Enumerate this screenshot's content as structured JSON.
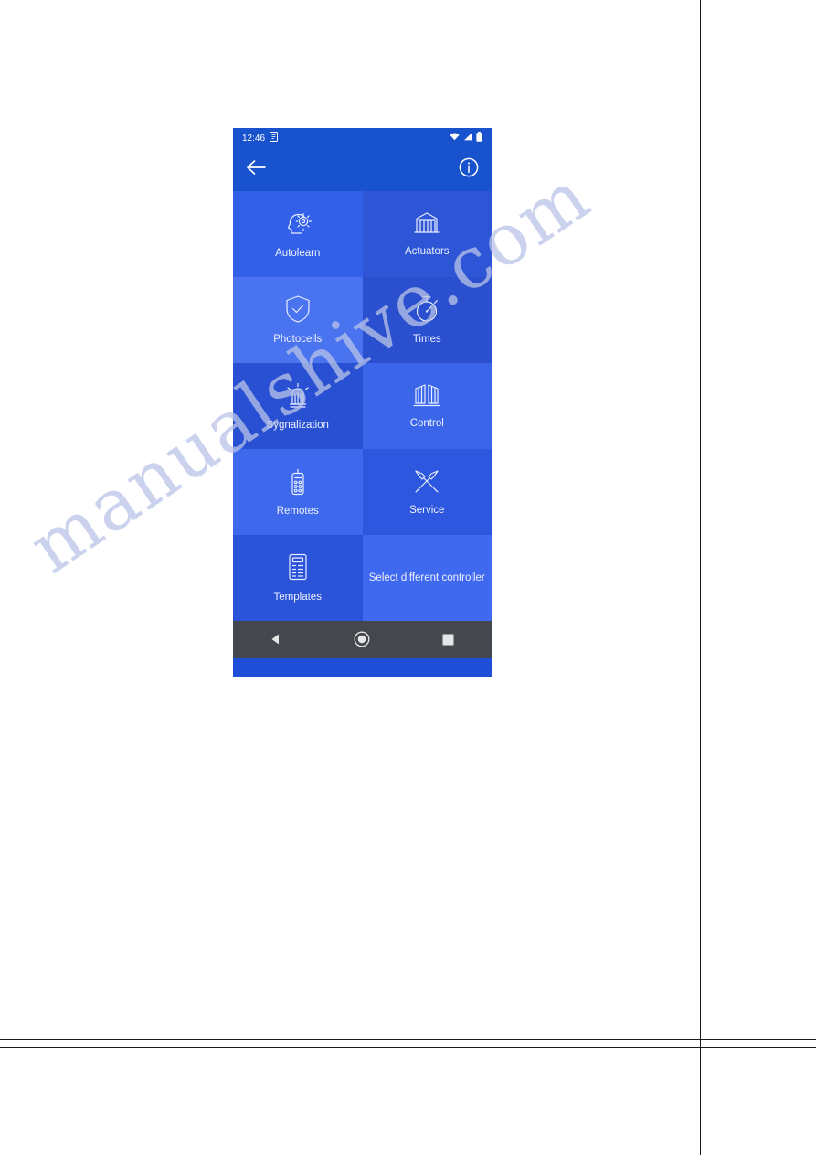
{
  "page": {
    "watermark_text": "manualshive.com"
  },
  "phone": {
    "status_bar": {
      "time": "12:46",
      "icons": [
        "screenshot-icon",
        "wifi-icon",
        "signal-icon",
        "battery-icon"
      ]
    },
    "app_bar": {
      "back_icon": "back-arrow-icon",
      "info_icon": "info-icon"
    },
    "tiles": [
      {
        "label": "Autolearn",
        "icon": "head-gear-icon"
      },
      {
        "label": "Actuators",
        "icon": "gate-barrier-icon"
      },
      {
        "label": "Photocells",
        "icon": "shield-check-icon"
      },
      {
        "label": "Times",
        "icon": "stopwatch-icon"
      },
      {
        "label": "Sygnalization",
        "icon": "warning-lamp-icon"
      },
      {
        "label": "Control",
        "icon": "double-gate-icon"
      },
      {
        "label": "Remotes",
        "icon": "remote-control-icon"
      },
      {
        "label": "Service",
        "icon": "wrench-screwdriver-icon"
      },
      {
        "label": "Templates",
        "icon": "document-list-icon"
      },
      {
        "label": "Select different controller",
        "icon": ""
      }
    ],
    "nav_bar": {
      "back_label": "back-triangle-icon",
      "home_label": "home-circle-icon",
      "recents_label": "recents-square-icon"
    }
  },
  "colors": {
    "app_bar": "#1852cd",
    "grid_base": "#1f4fd8",
    "nav_bar": "#44474d",
    "tile_text": "#eef2ff"
  }
}
